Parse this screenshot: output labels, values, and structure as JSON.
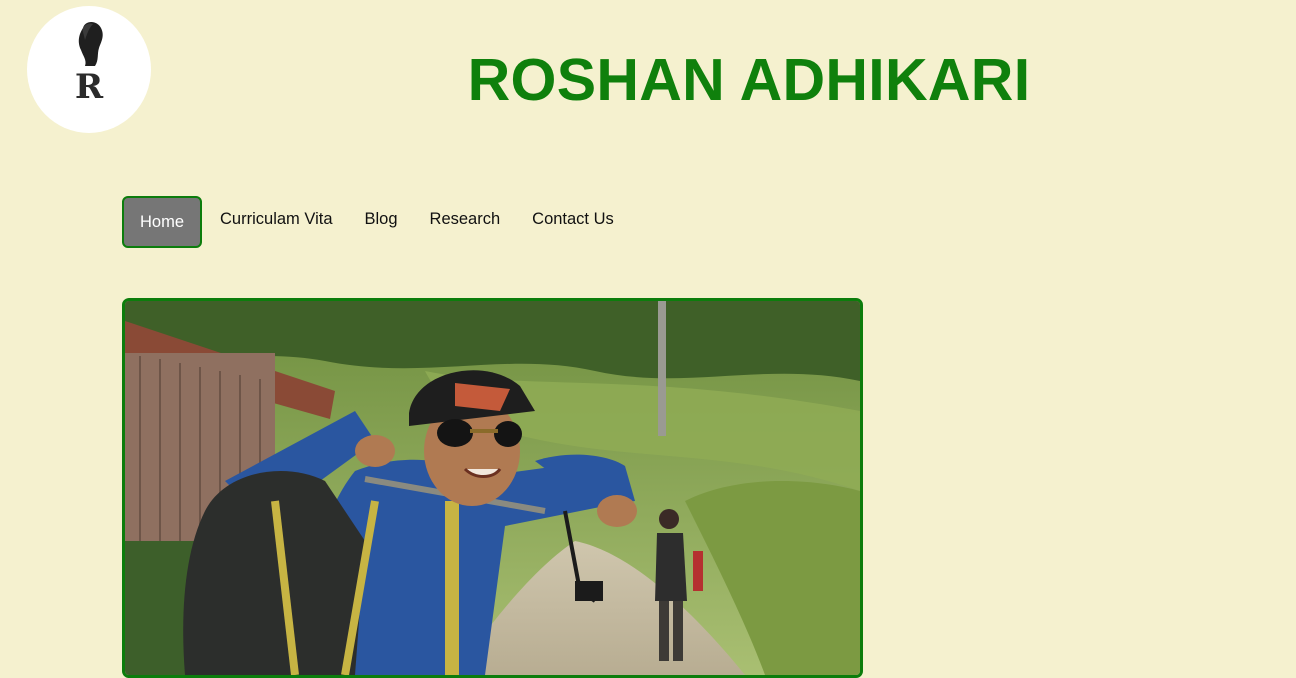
{
  "header": {
    "logo_letter": "R",
    "title": "ROSHAN ADHIKARI"
  },
  "nav": {
    "items": [
      {
        "label": "Home",
        "active": true
      },
      {
        "label": "Curriculam Vita",
        "active": false
      },
      {
        "label": "Blog",
        "active": false
      },
      {
        "label": "Research",
        "active": false
      },
      {
        "label": "Contact Us",
        "active": false
      }
    ]
  },
  "colors": {
    "background": "#f5f1cf",
    "title": "#0f800c",
    "accent_border": "#0c7d0c",
    "active_nav_bg": "#767676"
  },
  "hero": {
    "image_icon": "hiker-photo"
  }
}
